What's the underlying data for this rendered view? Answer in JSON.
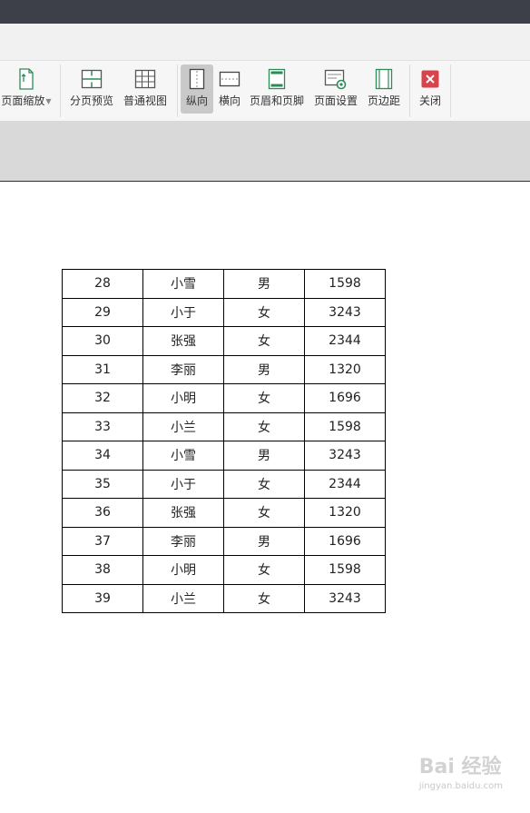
{
  "ribbon": {
    "page_zoom": "页面缩放",
    "page_break_preview": "分页预览",
    "normal_view": "普通视图",
    "portrait": "纵向",
    "landscape": "横向",
    "header_footer": "页眉和页脚",
    "page_setup": "页面设置",
    "margins": "页边距",
    "close": "关闭"
  },
  "table": {
    "rows": [
      {
        "id": "28",
        "name": "小雪",
        "gender": "男",
        "value": "1598"
      },
      {
        "id": "29",
        "name": "小于",
        "gender": "女",
        "value": "3243"
      },
      {
        "id": "30",
        "name": "张强",
        "gender": "女",
        "value": "2344"
      },
      {
        "id": "31",
        "name": "李丽",
        "gender": "男",
        "value": "1320"
      },
      {
        "id": "32",
        "name": "小明",
        "gender": "女",
        "value": "1696"
      },
      {
        "id": "33",
        "name": "小兰",
        "gender": "女",
        "value": "1598"
      },
      {
        "id": "34",
        "name": "小雪",
        "gender": "男",
        "value": "3243"
      },
      {
        "id": "35",
        "name": "小于",
        "gender": "女",
        "value": "2344"
      },
      {
        "id": "36",
        "name": "张强",
        "gender": "女",
        "value": "1320"
      },
      {
        "id": "37",
        "name": "李丽",
        "gender": "男",
        "value": "1696"
      },
      {
        "id": "38",
        "name": "小明",
        "gender": "女",
        "value": "1598"
      },
      {
        "id": "39",
        "name": "小兰",
        "gender": "女",
        "value": "3243"
      }
    ]
  },
  "watermark": {
    "text": "Bai 经验",
    "url": "jingyan.baidu.com"
  },
  "colors": {
    "titlebar": "#3d4048",
    "ribbon": "#f6f6f6",
    "accent_green": "#2e8b57",
    "close_red": "#d9434b"
  }
}
